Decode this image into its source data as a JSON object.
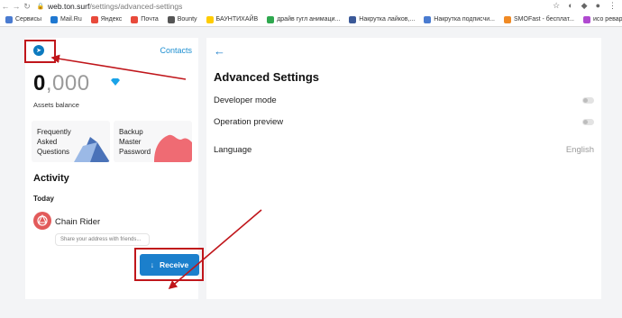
{
  "browser": {
    "url_host": "web.ton.surf",
    "url_path": "/settings/advanced-settings",
    "bookmarks": [
      {
        "label": "Сервисы",
        "color": "#4a7bd0"
      },
      {
        "label": "Mail.Ru",
        "color": "#1f78d1"
      },
      {
        "label": "Яндекс",
        "color": "#e84a3b"
      },
      {
        "label": "Почта",
        "color": "#e84a3b"
      },
      {
        "label": "Bounty",
        "color": "#555555"
      },
      {
        "label": "БАУНТИХАЙВ",
        "color": "#ffcc00"
      },
      {
        "label": "драйв гугл анимаци...",
        "color": "#2fa84f"
      },
      {
        "label": "Накрутка лайков,...",
        "color": "#3b5998"
      },
      {
        "label": "Накрутка подписчи...",
        "color": "#4a7bd0"
      },
      {
        "label": "SMOFast - бесплат...",
        "color": "#f08a24"
      },
      {
        "label": "исо ревард",
        "color": "#b04ad0"
      }
    ]
  },
  "wallet": {
    "contacts_label": "Contacts",
    "balance_int": "0",
    "balance_dec": ",000",
    "balance_label": "Assets balance",
    "tiles": [
      {
        "label": "Frequently Asked Questions"
      },
      {
        "label": "Backup Master Password"
      }
    ],
    "activity_title": "Activity",
    "today_label": "Today",
    "contact_name": "Chain Rider",
    "share_placeholder": "Share your address with friends...",
    "receive_label": "Receive",
    "accent": "#1b7fcc",
    "annotation_color": "#c0161b"
  },
  "settings": {
    "title": "Advanced Settings",
    "developer_mode_label": "Developer mode",
    "developer_mode_on": false,
    "operation_preview_label": "Operation preview",
    "operation_preview_on": false,
    "language_label": "Language",
    "language_value": "English"
  }
}
